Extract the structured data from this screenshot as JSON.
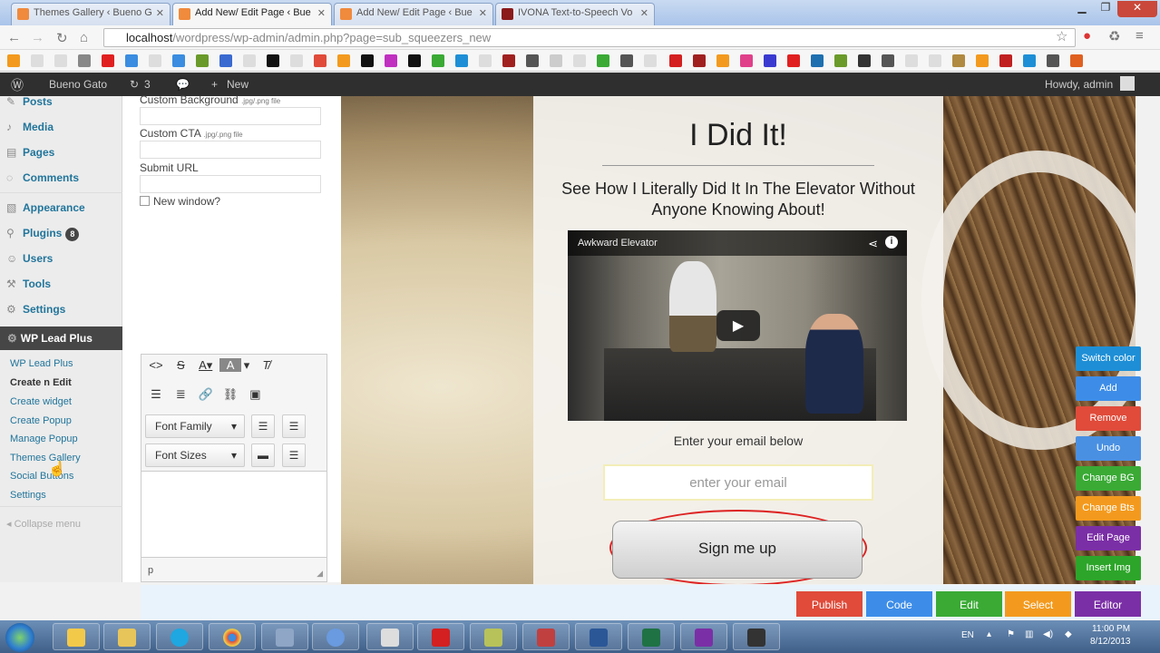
{
  "browser": {
    "tabs": [
      {
        "title": "Themes Gallery ‹ Bueno G",
        "active": false
      },
      {
        "title": "Add New/ Edit Page ‹ Bue",
        "active": true
      },
      {
        "title": "Add New/ Edit Page ‹ Bue",
        "active": false
      },
      {
        "title": "IVONA Text-to-Speech Vo",
        "active": false
      }
    ],
    "url_host": "localhost",
    "url_path": "/wordpress/wp-admin/admin.php?page=sub_squeezers_new"
  },
  "adminbar": {
    "site_name": "Bueno Gato",
    "updates_count": "3",
    "new_label": "New",
    "howdy": "Howdy, admin"
  },
  "sidebar": {
    "menu": [
      {
        "label": "Posts",
        "icon": "pin-icon"
      },
      {
        "label": "Media",
        "icon": "media-icon"
      },
      {
        "label": "Pages",
        "icon": "page-icon"
      },
      {
        "label": "Comments",
        "icon": "comment-icon"
      },
      {
        "label": "Appearance",
        "icon": "appearance-icon"
      },
      {
        "label": "Plugins",
        "icon": "plugin-icon",
        "badge": "8"
      },
      {
        "label": "Users",
        "icon": "users-icon"
      },
      {
        "label": "Tools",
        "icon": "tools-icon"
      },
      {
        "label": "Settings",
        "icon": "settings-icon"
      }
    ],
    "active_plugin": "WP Lead Plus",
    "submenu": [
      "WP Lead Plus",
      "Create n Edit",
      "Create widget",
      "Create Popup",
      "Manage Popup",
      "Themes Gallery",
      "Social Buttons",
      "Settings"
    ],
    "collapse_label": "Collapse menu"
  },
  "editor": {
    "custom_background_label": "Custom Background",
    "custom_background_hint": ".jpg/.png file",
    "custom_cta_label": "Custom CTA",
    "custom_cta_hint": ".jpg/.png file",
    "submit_url_label": "Submit URL",
    "new_window_label": "New window?",
    "font_family_label": "Font Family",
    "font_sizes_label": "Font Sizes",
    "status_path": "p"
  },
  "landing": {
    "headline": "I Did It!",
    "subheadline": "See How I Literally Did It In The Elevator Without Anyone Knowing About!",
    "video_title": "Awkward Elevator",
    "email_label": "Enter your email below",
    "email_placeholder": "enter your email",
    "signup_label": "Sign me up"
  },
  "side_buttons": [
    {
      "label": "Switch color",
      "color": "#1e8fd6"
    },
    {
      "label": "Add",
      "color": "#3d8de8"
    },
    {
      "label": "Remove",
      "color": "#e04b3a"
    },
    {
      "label": "Undo",
      "color": "#4a90e2"
    },
    {
      "label": "Change BG",
      "color": "#3aaa35"
    },
    {
      "label": "Change Bts",
      "color": "#f39a1e"
    },
    {
      "label": "Edit Page",
      "color": "#7b2fa6"
    },
    {
      "label": "Insert Img",
      "color": "#2da52a"
    }
  ],
  "bottom_buttons": [
    {
      "label": "Publish",
      "color": "#e04b3a"
    },
    {
      "label": "Code",
      "color": "#3d8de8"
    },
    {
      "label": "Edit",
      "color": "#3aaa35"
    },
    {
      "label": "Select",
      "color": "#f39a1e"
    },
    {
      "label": "Editor",
      "color": "#7b2fa6"
    }
  ],
  "taskbar": {
    "language": "EN",
    "time": "11:00 PM",
    "date": "8/12/2013"
  }
}
